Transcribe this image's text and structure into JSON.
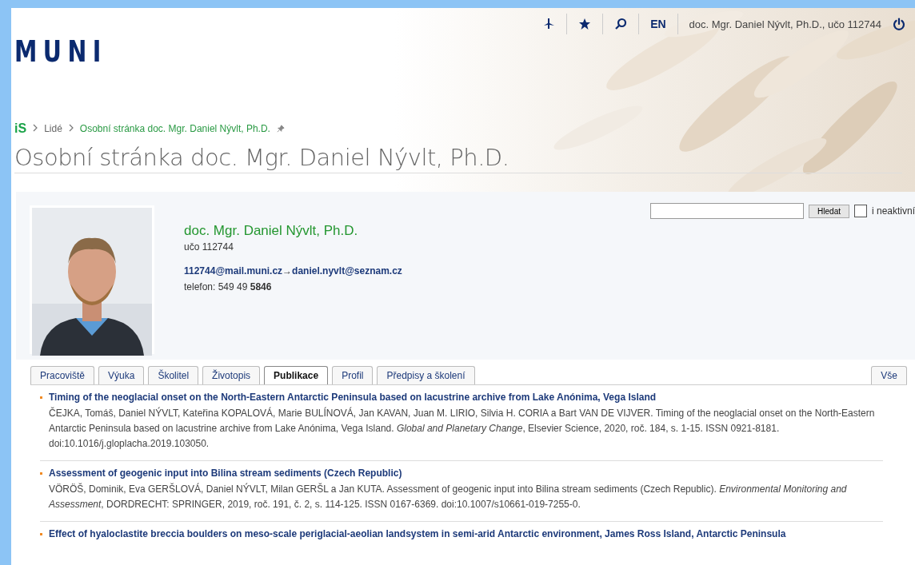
{
  "header": {
    "logo": "MUNI",
    "language": "EN",
    "user": "doc. Mgr. Daniel Nývlt, Ph.D., učo 112744"
  },
  "breadcrumb": {
    "logo": "iS",
    "items": [
      {
        "label": "Lidé",
        "current": false
      },
      {
        "label": "Osobní stránka doc. Mgr. Daniel Nývlt, Ph.D.",
        "current": true
      }
    ]
  },
  "page_title": "Osobní stránka doc. Mgr. Daniel Nývlt, Ph.D.",
  "profile": {
    "name": "doc. Mgr. Daniel Nývlt, Ph.D.",
    "uco": "učo 112744",
    "email": "112744@mail.muni.cz",
    "arrow": "→",
    "forward_email": "daniel.nyvlt@seznam.cz",
    "phone": "telefon: 549 49 **5846**"
  },
  "search": {
    "button": "Hledat",
    "checkbox_label": "i neaktivní",
    "checked": false
  },
  "tabs": [
    {
      "label": "Pracoviště",
      "selected": false
    },
    {
      "label": "Výuka",
      "selected": false
    },
    {
      "label": "Školitel",
      "selected": false
    },
    {
      "label": "Životopis",
      "selected": false
    },
    {
      "label": "Publikace",
      "selected": true
    },
    {
      "label": "Profil",
      "selected": false
    },
    {
      "label": "Předpisy a školení",
      "selected": false
    }
  ],
  "all_tab": {
    "label": "Vše",
    "selected": false
  },
  "publications": [
    {
      "title": "Timing of the neoglacial onset on the North-Eastern Antarctic Peninsula based on lacustrine archive from Lake Anónima, Vega Island",
      "citation": "ČEJKA, Tomáš, Daniel NÝVLT, Kateřina KOPALOVÁ, Marie BULÍNOVÁ, Jan KAVAN, Juan M. LIRIO, Silvia H. CORIA a Bart VAN DE VIJVER. Timing of the neoglacial onset on the North-Eastern Antarctic Peninsula based on lacustrine archive from Lake Anónima, Vega Island. *Global and Planetary Change*, Elsevier Science, 2020, roč. 184, s. 1-15. ISSN 0921-8181. doi:10.1016/j.gloplacha.2019.103050."
    },
    {
      "title": "Assessment of geogenic input into Bilina stream sediments (Czech Republic)",
      "citation": "VÖRÖŠ, Dominik, Eva GERŠLOVÁ, Daniel NÝVLT, Milan GERŠL a Jan KUTA. Assessment of geogenic input into Bilina stream sediments (Czech Republic). *Environmental Monitoring and Assessment*, DORDRECHT: SPRINGER, 2019, roč. 191, č. 2, s. 114-125. ISSN 0167-6369. doi:10.1007/s10661-019-7255-0."
    },
    {
      "title": "Effect of hyaloclastite breccia boulders on meso-scale periglacial-aeolian landsystem in semi-arid Antarctic environment, James Ross Island, Antarctic Peninsula"
    }
  ]
}
